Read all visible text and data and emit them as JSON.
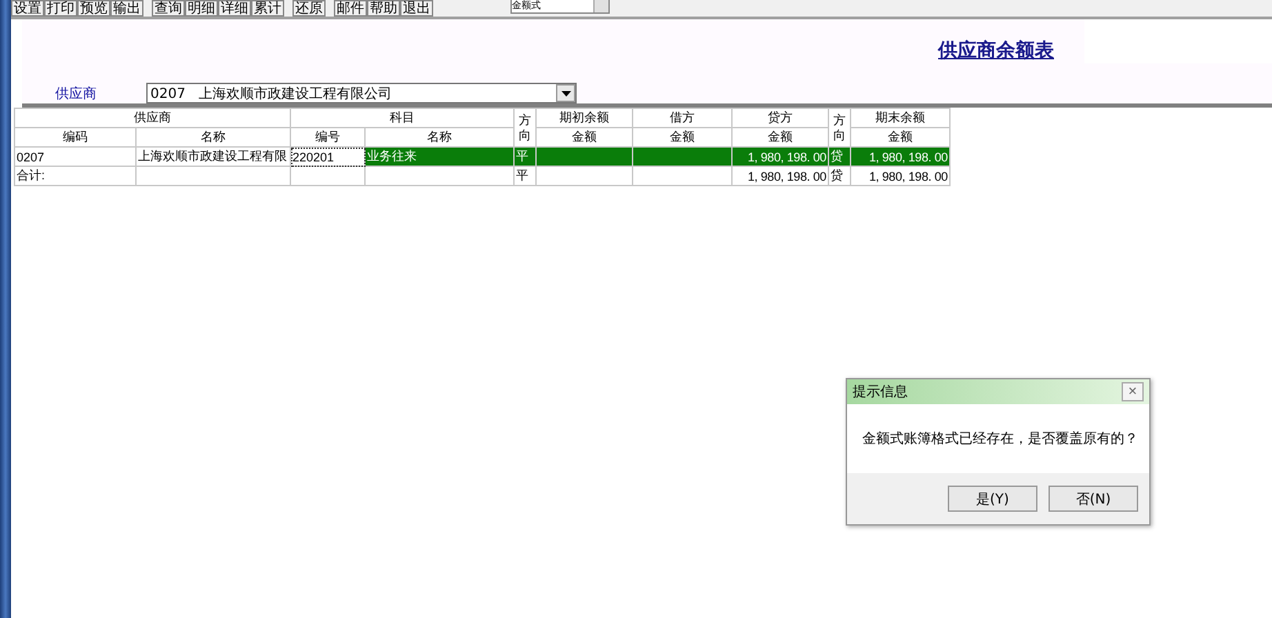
{
  "toolbar": {
    "buttons": [
      "设置",
      "打印",
      "预览",
      "输出",
      "查询",
      "明细",
      "详细",
      "累计",
      "还原",
      "邮件",
      "帮助",
      "退出"
    ],
    "format_combo": "金额式"
  },
  "report": {
    "title": "供应商余额表",
    "supplier_label": "供应商",
    "supplier_value": "0207   上海欢顺市政建设工程有限公司"
  },
  "table": {
    "groups": [
      "供应商",
      "科目",
      "期初余额",
      "借方",
      "贷方",
      "期末余额"
    ],
    "columns": [
      "编码",
      "名称",
      "编号",
      "名称",
      "方向",
      "金额",
      "金额",
      "金额",
      "方向",
      "金额"
    ],
    "rows": [
      {
        "selected": true,
        "cells": [
          "0207",
          "上海欢顺市政建设工程有限",
          "220201",
          "业务往来",
          "平",
          "",
          "",
          "1, 980, 198. 00",
          "贷",
          "1, 980, 198. 00"
        ]
      },
      {
        "selected": false,
        "cells": [
          "合计:",
          "",
          "",
          "",
          "平",
          "",
          "",
          "1, 980, 198. 00",
          "贷",
          "1, 980, 198. 00"
        ]
      }
    ]
  },
  "dialog": {
    "title": "提示信息",
    "close": "×",
    "message": "金额式账簿格式已经存在，是否覆盖原有的？",
    "buttons": [
      "是(Y)",
      "否(N)"
    ]
  }
}
